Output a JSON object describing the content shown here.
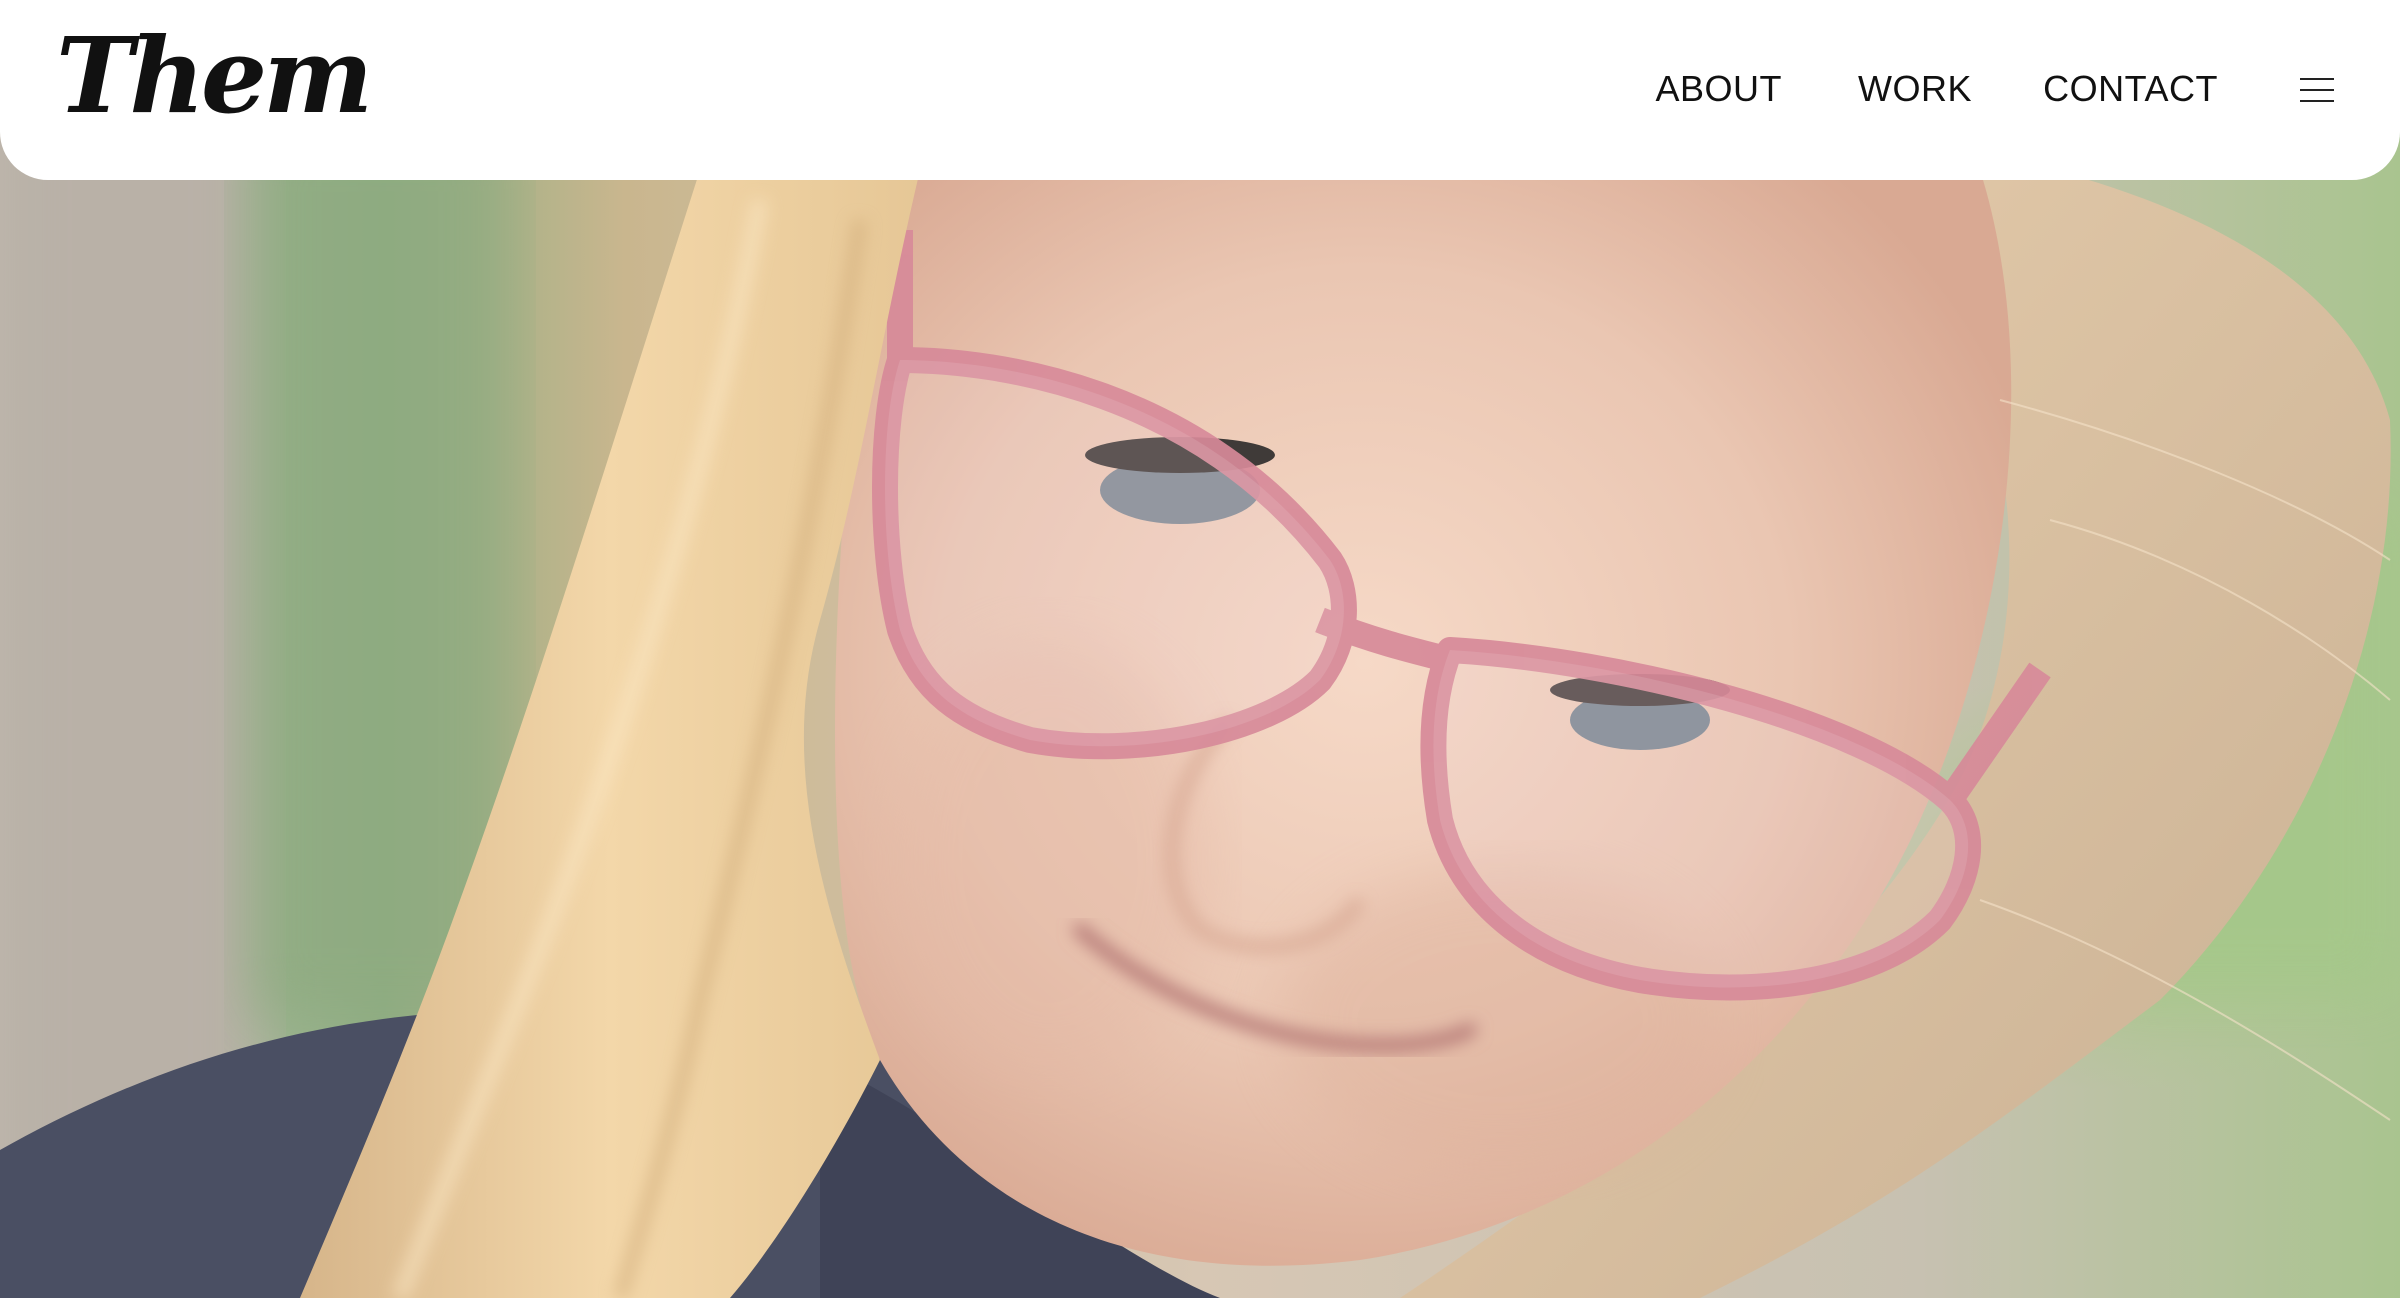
{
  "brand": {
    "logo_text": "Them"
  },
  "nav": {
    "items": [
      {
        "label": "ABOUT"
      },
      {
        "label": "WORK"
      },
      {
        "label": "CONTACT"
      }
    ],
    "menu_icon": "hamburger-icon"
  },
  "hero": {
    "media": "video-frame-child-with-pink-glasses"
  },
  "colors": {
    "header_bg": "#ffffff",
    "text": "#111111"
  }
}
